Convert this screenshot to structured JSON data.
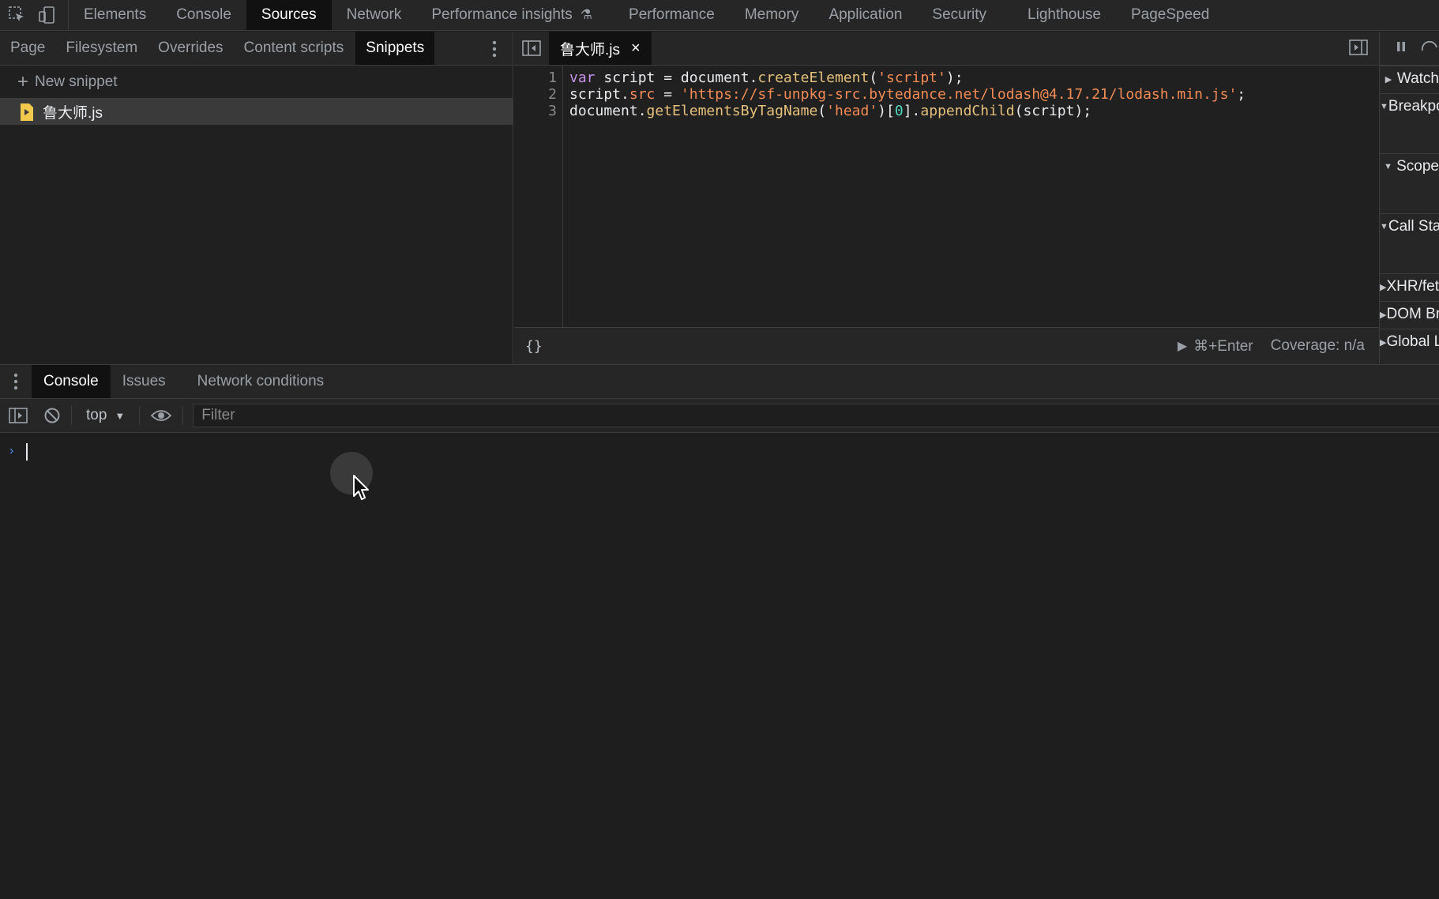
{
  "main_tabs": [
    {
      "label": "Elements"
    },
    {
      "label": "Console"
    },
    {
      "label": "Sources"
    },
    {
      "label": "Network"
    },
    {
      "label": "Performance insights"
    },
    {
      "label": "Performance"
    },
    {
      "label": "Memory"
    },
    {
      "label": "Application"
    },
    {
      "label": "Security"
    },
    {
      "label": "Lighthouse"
    },
    {
      "label": "PageSpeed"
    }
  ],
  "active_main_tab": "Sources",
  "navigator": {
    "tabs": [
      "Page",
      "Filesystem",
      "Overrides",
      "Content scripts",
      "Snippets"
    ],
    "active_tab": "Snippets",
    "new_snippet_label": "New snippet",
    "files": [
      "鲁大师.js"
    ]
  },
  "editor": {
    "open_file": "鲁大师.js",
    "lines": [
      "var script = document.createElement('script');",
      "script.src = 'https://sf-unpkg-src.bytedance.net/lodash@4.17.21/lodash.min.js';",
      "document.getElementsByTagName('head')[0].appendChild(script);"
    ],
    "line_numbers": [
      "1",
      "2",
      "3"
    ],
    "tokens": {
      "l1": [
        "var",
        " script = document.",
        "createElement",
        "(",
        "'script'",
        ");"
      ],
      "l2": [
        "script.",
        "src",
        " = ",
        "'https://sf-unpkg-src.bytedance.net/lodash@4.17.21/lodash.min.js'",
        ";"
      ],
      "l3": [
        "document.",
        "getElementsByTagName",
        "(",
        "'head'",
        ")[",
        "0",
        "].",
        "appendChild",
        "(script);"
      ]
    },
    "format_label": "{}",
    "run_shortcut": "⌘+Enter",
    "coverage": "Coverage: n/a"
  },
  "debugger": {
    "sections": [
      {
        "label": "Watch",
        "expanded": false
      },
      {
        "label": "Breakpoints",
        "expanded": true
      },
      {
        "label": "Scope",
        "expanded": true
      },
      {
        "label": "Call Stack",
        "expanded": true
      },
      {
        "label": "XHR/fetch Breakpoints",
        "expanded": false
      },
      {
        "label": "DOM Breakpoints",
        "expanded": false
      },
      {
        "label": "Global Listeners",
        "expanded": false
      }
    ]
  },
  "drawer": {
    "tabs": [
      "Console",
      "Issues",
      "Network conditions"
    ],
    "active_tab": "Console"
  },
  "console": {
    "context": "top",
    "filter_placeholder": "Filter",
    "prompt": "›"
  },
  "colors": {
    "background": "#1e1e1e",
    "panel": "#262626",
    "keyword": "#c792ea",
    "function": "#e5c07b",
    "string": "#f28b54",
    "number": "#4fd6be",
    "prompt": "#4a8cff"
  }
}
